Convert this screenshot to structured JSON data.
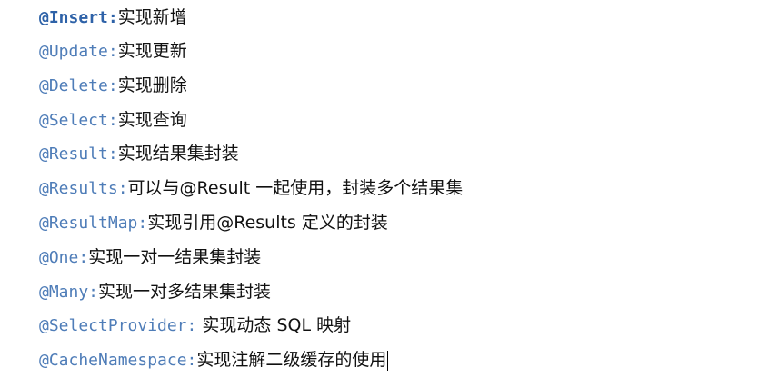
{
  "annotations": [
    {
      "name": "@Insert:",
      "desc": "实现新增"
    },
    {
      "name": "@Update:",
      "desc": "实现更新"
    },
    {
      "name": "@Delete:",
      "desc": "实现删除"
    },
    {
      "name": "@Select:",
      "desc": "实现查询"
    },
    {
      "name": "@Result:",
      "desc": "实现结果集封装"
    },
    {
      "name": "@Results:",
      "desc": "可以与@Result 一起使用，封装多个结果集"
    },
    {
      "name": "@ResultMap:",
      "desc": "实现引用@Results 定义的封装"
    },
    {
      "name": "@One:",
      "desc": "实现一对一结果集封装"
    },
    {
      "name": "@Many:",
      "desc": "实现一对多结果集封装"
    },
    {
      "name": "@SelectProvider:",
      "desc": " 实现动态 SQL 映射"
    },
    {
      "name": "@CacheNamespace:",
      "desc": "实现注解二级缓存的使用"
    }
  ]
}
